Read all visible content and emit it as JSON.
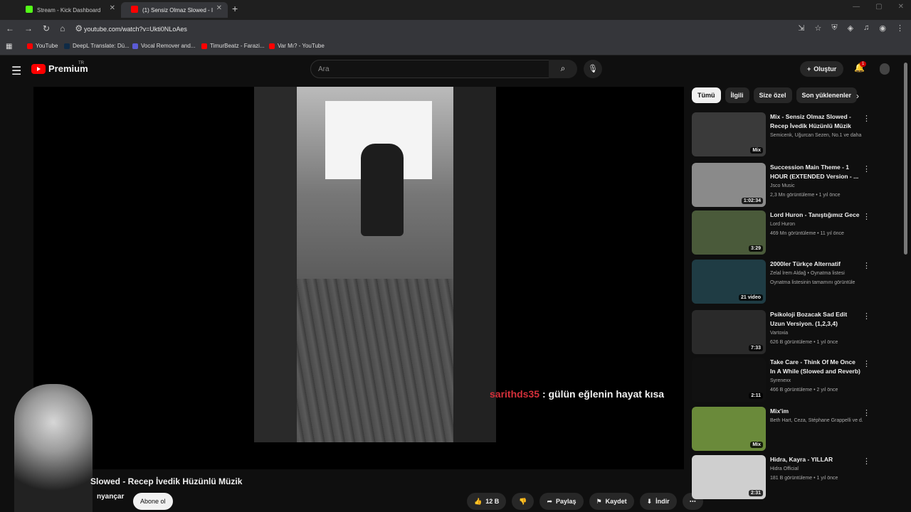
{
  "browser": {
    "tabs": [
      {
        "title": "Stream - Kick Dashboard",
        "favicon_color": "#53fc18"
      },
      {
        "title": "(1) Sensiz Olmaz Slowed - I",
        "favicon_color": "#ff0000"
      }
    ],
    "url": "youtube.com/watch?v=Ukti0NLoAes",
    "bookmarks": [
      {
        "label": "YouTube",
        "color": "#ff0000"
      },
      {
        "label": "DeepL Translate: Dü...",
        "color": "#0f2b46"
      },
      {
        "label": "Vocal Remover and...",
        "color": "#5b5bd6"
      },
      {
        "label": "TimurBeatz - Farazi...",
        "color": "#ff0000"
      },
      {
        "label": "Var Mı? - YouTube",
        "color": "#ff0000"
      }
    ]
  },
  "header": {
    "logo_text": "Premium",
    "logo_region": "TR",
    "search_placeholder": "Ara",
    "create_label": "Oluştur",
    "notif_count": "1"
  },
  "player": {
    "chat_user": "sarithds35",
    "chat_text": ": gülün eğlenin hayat kısa"
  },
  "video": {
    "title": "Slowed - Recep İvedik Hüzünlü Müzik",
    "channel": "nyançar",
    "subscribe_label": "Abone ol",
    "likes": "12 B",
    "share_label": "Paylaş",
    "save_label": "Kaydet",
    "download_label": "İndir"
  },
  "chips": [
    "Tümü",
    "İlgili",
    "Size özel",
    "Son yüklenenler"
  ],
  "recommendations": [
    {
      "title": "Mix - Sensiz Olmaz Slowed - Recep İvedik Hüzünlü Müzik",
      "line1": "Semicenk, Uğurcan Sezen, No.1 ve daha ...",
      "line2": "",
      "badge": "Mix",
      "thumb": "#3a3a3a"
    },
    {
      "title": "Succession Main Theme - 1 HOUR (EXTENDED Version - ...",
      "line1": "Jsco Music",
      "line2": "2,3 Mn görüntüleme • 1 yıl önce",
      "badge": "1:02:34",
      "thumb": "#8a8a8a"
    },
    {
      "title": "Lord Huron - Tanıştığımız Gece",
      "line1": "Lord Huron",
      "line2": "469 Mn görüntüleme • 11 yıl önce",
      "badge": "3:29",
      "thumb": "#4a5a3a"
    },
    {
      "title": "2000ler Türkçe Alternatif",
      "line1": "Zelal İrem Aldağ • Oynatma listesi",
      "line2": "Oynatma listesinin tamamını görüntüle",
      "badge": "21 video",
      "thumb": "#1f3c44"
    },
    {
      "title": "Psikoloji Bozacak Sad Edit Uzun Versiyon. (1,2,3,4)",
      "line1": "Vartoxia",
      "line2": "626 B görüntüleme • 1 yıl önce",
      "badge": "7:33",
      "thumb": "#2a2a2a"
    },
    {
      "title": "Take Care - Think Of Me Once In A While (Slowed and Reverb)",
      "line1": "Syrenexx",
      "line2": "466 B görüntüleme • 2 yıl önce",
      "badge": "2:11",
      "thumb": "#111"
    },
    {
      "title": "Mix'im",
      "line1": "Beth Hart, Ceza, Stéphane Grappelli ve d...",
      "line2": "",
      "badge": "Mix",
      "thumb": "#6a8a3a"
    },
    {
      "title": "Hidra, Kayra - YILLAR",
      "line1": "Hidra Official",
      "line2": "181 B görüntüleme • 1 yıl önce",
      "badge": "2:31",
      "thumb": "#cfcfcf"
    }
  ]
}
